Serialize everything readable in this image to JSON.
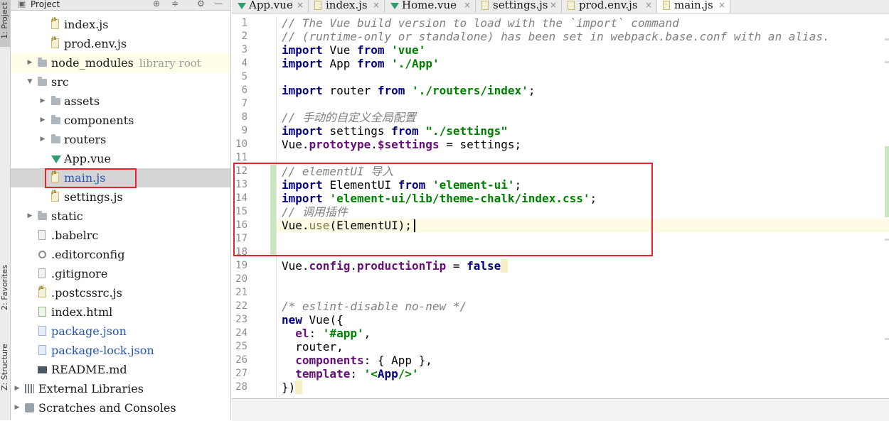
{
  "tool_strip": {
    "project_tab": "1: Project",
    "favorites_tab": "2: Favorites",
    "structure_tab": "Z: Structure"
  },
  "project_panel": {
    "title": "Project",
    "tree": [
      {
        "label": "index.js",
        "icon": "js-file-icon"
      },
      {
        "label": "prod.env.js",
        "icon": "js-file-icon"
      },
      {
        "label": "node_modules",
        "hint": "library root",
        "icon": "folder-icon"
      },
      {
        "label": "src",
        "icon": "folder-icon"
      },
      {
        "label": "assets",
        "icon": "folder-icon"
      },
      {
        "label": "components",
        "icon": "folder-icon"
      },
      {
        "label": "routers",
        "icon": "folder-icon"
      },
      {
        "label": "App.vue",
        "icon": "vue-file-icon"
      },
      {
        "label": "main.js",
        "icon": "js-file-icon"
      },
      {
        "label": "settings.js",
        "icon": "js-file-icon"
      },
      {
        "label": "static",
        "icon": "folder-icon"
      },
      {
        "label": ".babelrc",
        "icon": "config-file-icon"
      },
      {
        "label": ".editorconfig",
        "icon": "gear-file-icon"
      },
      {
        "label": ".gitignore",
        "icon": "text-file-icon"
      },
      {
        "label": ".postcssrc.js",
        "icon": "js-file-icon"
      },
      {
        "label": "index.html",
        "icon": "html-file-icon"
      },
      {
        "label": "package.json",
        "icon": "json-file-icon"
      },
      {
        "label": "package-lock.json",
        "icon": "json-file-icon"
      },
      {
        "label": "README.md",
        "icon": "markdown-file-icon"
      },
      {
        "label": "External Libraries",
        "icon": "library-icon"
      },
      {
        "label": "Scratches and Consoles",
        "icon": "scratch-icon"
      }
    ]
  },
  "editor": {
    "tabs": [
      {
        "label": "App.vue"
      },
      {
        "label": "index.js"
      },
      {
        "label": "Home.vue"
      },
      {
        "label": "settings.js"
      },
      {
        "label": "prod.env.js"
      },
      {
        "label": "main.js",
        "active": true
      }
    ],
    "line_numbers": [
      "1",
      "2",
      "3",
      "4",
      "5",
      "6",
      "7",
      "8",
      "9",
      "10",
      "11",
      "12",
      "13",
      "14",
      "15",
      "16",
      "17",
      "18",
      "19",
      "20",
      "21",
      "22",
      "23",
      "24",
      "25",
      "26",
      "27",
      "28"
    ],
    "code": {
      "l1": "// The Vue build version to load with the `import` command",
      "l2": "// (runtime-only or standalone) has been set in webpack.base.conf with an alias.",
      "import": "import",
      "from": "from",
      "l3_name": "Vue",
      "l3_str": "'vue'",
      "l4_name": "App",
      "l4_str": "'./App'",
      "l6_name": "router",
      "l6_str": "'./routers/index'",
      "semi": ";",
      "l8": "// 手动的自定义全局配置",
      "l9_name": "settings",
      "l9_str": "\"./settings\"",
      "l10_a": "Vue.",
      "l10_prop": "prototype",
      "l10_dot": ".",
      "l10_var": "$settings",
      "l10_b": " = settings;",
      "l12": "// elementUI 导入",
      "l13_name": "ElementUI",
      "l13_str": "'element-ui'",
      "l14_str": "'element-ui/lib/theme-chalk/index.css'",
      "l15": "// 调用插件",
      "l16_a": "Vue.",
      "l16_fn": "use",
      "l16_b": "(ElementUI);",
      "l19_a": "Vue.",
      "l19_prop1": "config",
      "l19_dot": ".",
      "l19_prop2": "productionTip",
      "l19_eq": " = ",
      "l19_kw": "false",
      "l22": "/* eslint-disable no-new */",
      "l23_kw": "new",
      "l23_b": " Vue({",
      "l24_prop": "el",
      "l24_colon": ": ",
      "l24_str": "'#app'",
      "l24_comma": ",",
      "l25": "  router,",
      "l26_prop": "components",
      "l26_b": ": { App },",
      "l27_prop": "template",
      "l27_colon": ": ",
      "l27_str_a": "'<",
      "l27_str_tag": "App",
      "l27_str_b": "/>'",
      "l28": "})"
    }
  },
  "colors": {
    "keyword": "#000080",
    "string": "#008000",
    "comment": "#808080",
    "property": "#660e7a",
    "annotation_box": "#e0262f"
  }
}
